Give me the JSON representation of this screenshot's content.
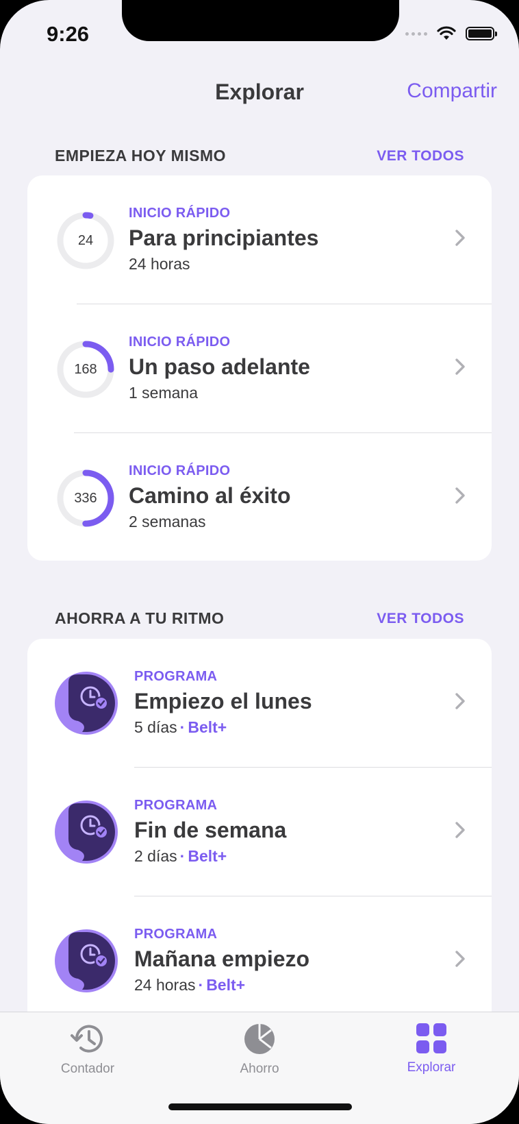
{
  "status": {
    "time": "9:26"
  },
  "nav": {
    "title": "Explorar",
    "action": "Compartir"
  },
  "section1": {
    "title": "EMPIEZA HOY MISMO",
    "link": "VER TODOS",
    "items": [
      {
        "kicker": "INICIO RÁPIDO",
        "title": "Para principiantes",
        "subtitle": "24 horas",
        "ring_value": "24",
        "progress": 0.03
      },
      {
        "kicker": "INICIO RÁPIDO",
        "title": "Un paso adelante",
        "subtitle": "1 semana",
        "ring_value": "168",
        "progress": 0.25
      },
      {
        "kicker": "INICIO RÁPIDO",
        "title": "Camino al éxito",
        "subtitle": "2 semanas",
        "ring_value": "336",
        "progress": 0.5
      }
    ]
  },
  "section2": {
    "title": "AHORRA A TU RITMO",
    "link": "VER TODOS",
    "items": [
      {
        "kicker": "PROGRAMA",
        "title": "Empiezo el lunes",
        "duration": "5 días",
        "dot": "·",
        "badge": "Belt+"
      },
      {
        "kicker": "PROGRAMA",
        "title": "Fin de semana",
        "duration": "2 días",
        "dot": "·",
        "badge": "Belt+"
      },
      {
        "kicker": "PROGRAMA",
        "title": "Mañana empiezo",
        "duration": "24 horas",
        "dot": "·",
        "badge": "Belt+"
      }
    ]
  },
  "tabs": [
    {
      "label": "Contador",
      "icon": "history-icon",
      "active": false
    },
    {
      "label": "Ahorro",
      "icon": "pie-chart-icon",
      "active": false
    },
    {
      "label": "Explorar",
      "icon": "grid-icon",
      "active": true
    }
  ],
  "colors": {
    "accent": "#7b5cf0",
    "ring_track": "#ececee",
    "icon_bg": "#a283f5",
    "icon_fg": "#3b2a6b"
  }
}
